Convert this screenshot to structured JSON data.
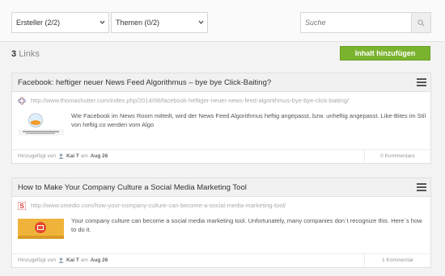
{
  "filters": {
    "creator_label": "Ersteller (2/2)",
    "topics_label": "Themen (0/2)"
  },
  "search": {
    "placeholder": "Suche"
  },
  "summary": {
    "count": "3",
    "count_label": "Links"
  },
  "actions": {
    "add_content_label": "Inhalt hinzufügen"
  },
  "colors": {
    "accent_green": "#7ab32e"
  },
  "cards": [
    {
      "title": "Facebook: heftiger neuer News Feed Algorithmus – bye bye Click-Baiting?",
      "url": "http://www.thomashutter.com/index.php/2014/08/facebook-heftiger-neuer-news-feed-algorithmus-bye-bye-click-baiting/",
      "description": "Wie Facebook im News Room mitteilt, wird der News Feed Algorithmus heftig angepasst, bzw. unheftig angepasst. Like-Bites im Stil von heftig.co werden vom Algo",
      "favicon": "link-favicon-icon",
      "added_by_label": "Hinzugefügt von",
      "author": "Kai T",
      "date_prefix": "am",
      "date": "Aug 26",
      "comments": "0 Kommentare"
    },
    {
      "title": "How to Make Your Company Culture a Social Media Marketing Tool",
      "url": "http://www.smedio.com/how-your-company-culture-can-become-a-social-media-marketing-tool/",
      "description": "Your company culture can become a social media marketing tool. Unfortunately, many companies don`t recognize this. Here`s how to do it.",
      "favicon": "smedio-favicon-icon",
      "added_by_label": "Hinzugefügt von",
      "author": "Kai T",
      "date_prefix": "am",
      "date": "Aug 26",
      "comments": "1 Kommentar"
    }
  ]
}
